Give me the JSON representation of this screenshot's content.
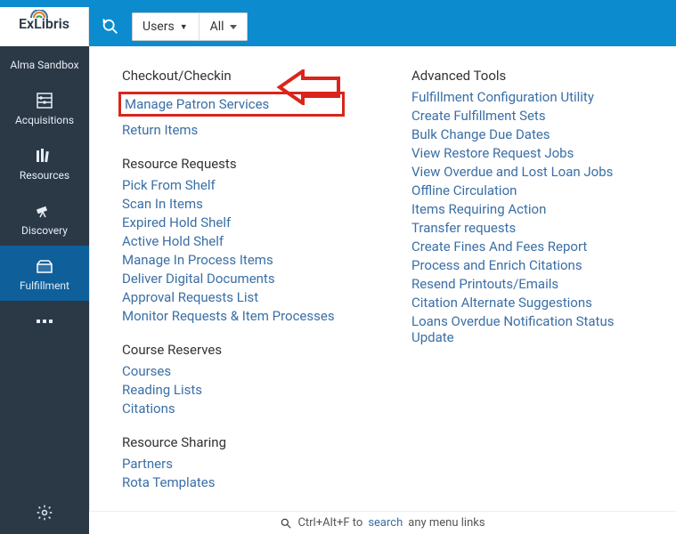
{
  "logo": {
    "text": "ExLibris"
  },
  "topbar": {
    "users_label": "Users",
    "users_caret": "▾",
    "all_label": "All"
  },
  "sidebar": {
    "items": [
      {
        "label": "Alma Sandbox",
        "icon": "switch"
      },
      {
        "label": "Acquisitions",
        "icon": "abacus"
      },
      {
        "label": "Resources",
        "icon": "books"
      },
      {
        "label": "Discovery",
        "icon": "telescope"
      },
      {
        "label": "Fulfillment",
        "icon": "box-open"
      },
      {
        "label": "",
        "icon": "more"
      }
    ]
  },
  "main": {
    "left": [
      {
        "title": "Checkout/Checkin",
        "links": [
          "Manage Patron Services",
          "Return Items"
        ],
        "highlight_index": 0
      },
      {
        "title": "Resource Requests",
        "links": [
          "Pick From Shelf",
          "Scan In Items",
          "Expired Hold Shelf",
          "Active Hold Shelf",
          "Manage In Process Items",
          "Deliver Digital Documents",
          "Approval Requests List",
          "Monitor Requests & Item Processes"
        ]
      },
      {
        "title": "Course Reserves",
        "links": [
          "Courses",
          "Reading Lists",
          "Citations"
        ]
      },
      {
        "title": "Resource Sharing",
        "links": [
          "Partners",
          "Rota Templates"
        ]
      }
    ],
    "right": [
      {
        "title": "Advanced Tools",
        "links": [
          "Fulfillment Configuration Utility",
          "Create Fulfillment Sets",
          "Bulk Change Due Dates",
          "View Restore Request Jobs",
          "View Overdue and Lost Loan Jobs",
          "Offline Circulation",
          "Items Requiring Action",
          "Transfer requests",
          "Create Fines And Fees Report",
          "Process and Enrich Citations",
          "Resend Printouts/Emails",
          "Citation Alternate Suggestions",
          "Loans Overdue Notification Status Update"
        ]
      }
    ]
  },
  "bottom_hint": {
    "pre": "Ctrl+Alt+F to ",
    "link": "search",
    "post": " any menu links"
  }
}
